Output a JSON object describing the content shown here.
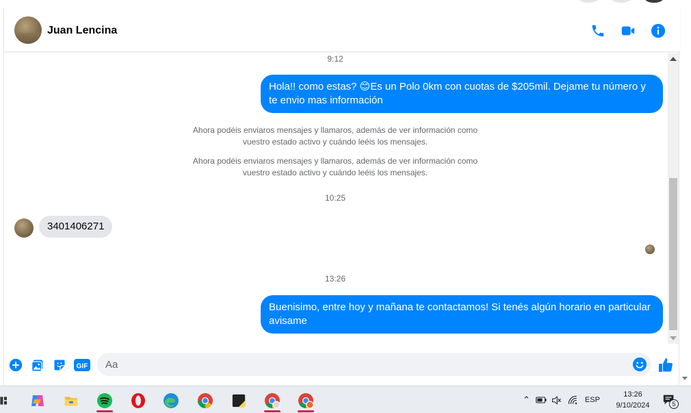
{
  "header": {
    "contact_name": "Juan Lencina",
    "icons": [
      "phone-icon",
      "video-camera-icon",
      "info-icon"
    ],
    "accent_color": "#0084ff"
  },
  "messages": {
    "time1": "9:12",
    "outgoing1": "Hola!! como estas? 😊Es un Polo 0km con cuotas de $205mil. Dejame tu número y te envio mas información",
    "system1_line1": "Ahora podéis enviaros mensajes y llamaros, además de ver información como",
    "system1_line2": "vuestro estado activo y cuándo leéis los mensajes.",
    "system2_line1": "Ahora podéis enviaros mensajes y llamaros, además de ver información como",
    "system2_line2": "vuestro estado activo y cuándo leéis los mensajes.",
    "time2": "10:25",
    "incoming1": "3401406271",
    "time3": "13:26",
    "outgoing2": "Buenisimo, entre hoy y mañana te contactamos! Si tenés algún horario en particular avisame"
  },
  "composer": {
    "placeholder": "Aa",
    "icons": [
      "plus-circle-icon",
      "photo-icon",
      "sticker-icon",
      "gif-icon",
      "emoji-icon",
      "like-thumb-icon"
    ],
    "gif_label": "GIF"
  },
  "taskbar": {
    "apps": [
      "task-view",
      "copilot",
      "file-explorer",
      "spotify",
      "opera",
      "edge",
      "chrome",
      "sticky-notes",
      "chrome-profile-1",
      "chrome-profile-2"
    ],
    "tray_lang": "ESP",
    "clock_time": "13:26",
    "clock_date": "9/10/2024",
    "notification_count": "5"
  }
}
